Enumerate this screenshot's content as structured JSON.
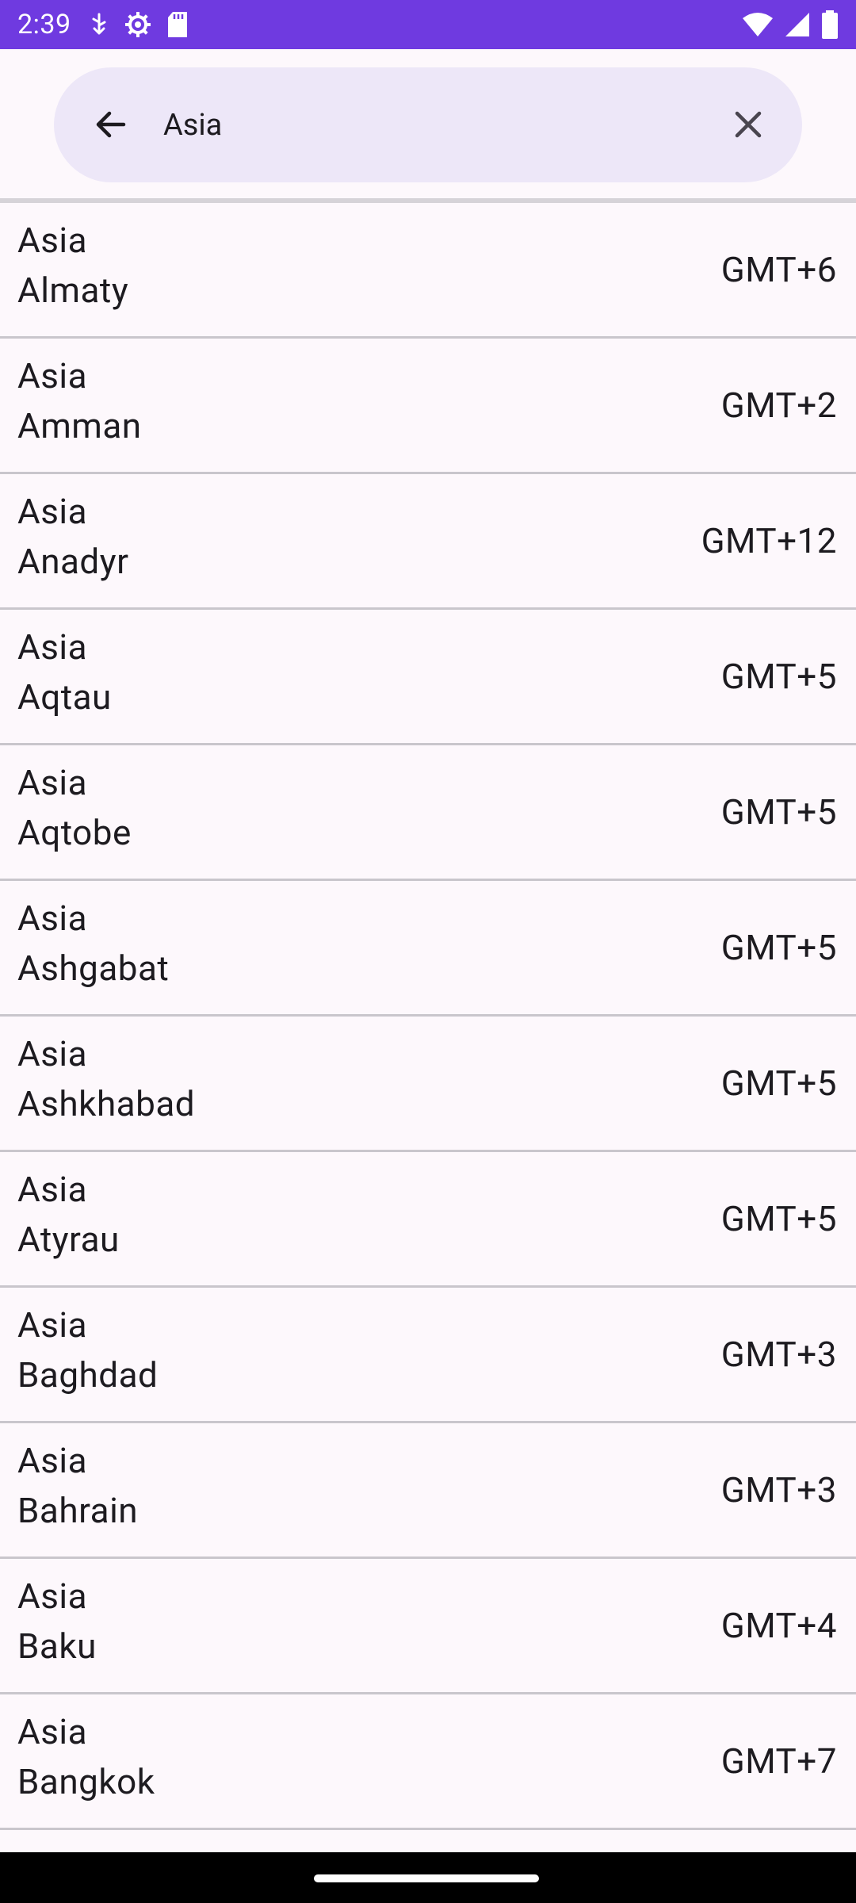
{
  "status_bar": {
    "time": "2:39",
    "left_icons": [
      "usb-icon",
      "settings-icon",
      "sd-card-icon"
    ],
    "right_icons": [
      "wifi-icon",
      "signal-icon",
      "battery-icon"
    ],
    "bg_color": "#6f3ae0"
  },
  "search": {
    "query": "Asia",
    "back_icon": "arrow-left-icon",
    "clear_icon": "close-icon",
    "bg_color": "#ede7f8"
  },
  "timezones": [
    {
      "region": "Asia",
      "city": "Almaty",
      "offset": "GMT+6"
    },
    {
      "region": "Asia",
      "city": "Amman",
      "offset": "GMT+2"
    },
    {
      "region": "Asia",
      "city": "Anadyr",
      "offset": "GMT+12"
    },
    {
      "region": "Asia",
      "city": "Aqtau",
      "offset": "GMT+5"
    },
    {
      "region": "Asia",
      "city": "Aqtobe",
      "offset": "GMT+5"
    },
    {
      "region": "Asia",
      "city": "Ashgabat",
      "offset": "GMT+5"
    },
    {
      "region": "Asia",
      "city": "Ashkhabad",
      "offset": "GMT+5"
    },
    {
      "region": "Asia",
      "city": "Atyrau",
      "offset": "GMT+5"
    },
    {
      "region": "Asia",
      "city": "Baghdad",
      "offset": "GMT+3"
    },
    {
      "region": "Asia",
      "city": "Bahrain",
      "offset": "GMT+3"
    },
    {
      "region": "Asia",
      "city": "Baku",
      "offset": "GMT+4"
    },
    {
      "region": "Asia",
      "city": "Bangkok",
      "offset": "GMT+7"
    }
  ]
}
